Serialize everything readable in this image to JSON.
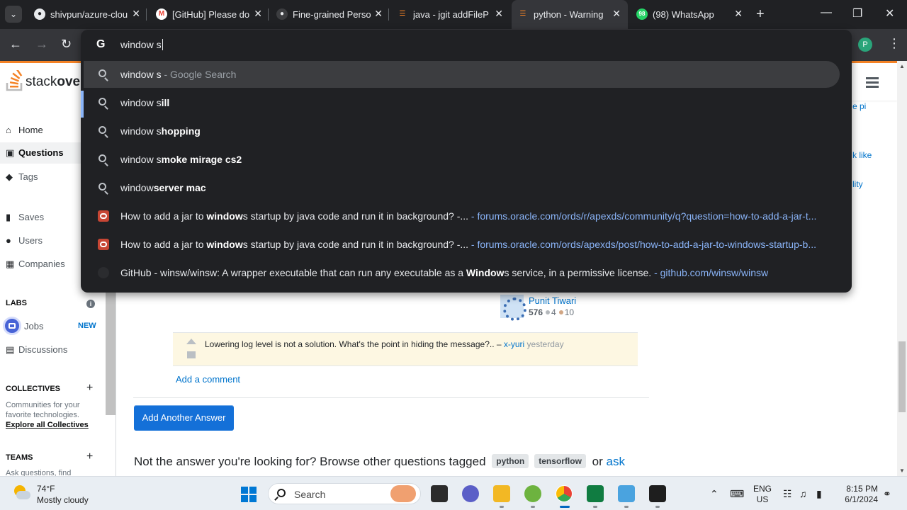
{
  "browser": {
    "tabs": [
      {
        "title": "shivpun/azure-clou",
        "icon": "github-icon"
      },
      {
        "title": "[GitHub] Please do",
        "icon": "gmail-icon"
      },
      {
        "title": "Fine-grained Perso",
        "icon": "github-icon"
      },
      {
        "title": "java - jgit addFileP",
        "icon": "stackoverflow-icon"
      },
      {
        "title": "python - Warning",
        "icon": "stackoverflow-icon",
        "active": true
      },
      {
        "title": "(98) WhatsApp",
        "icon": "whatsapp-icon"
      }
    ],
    "whatsapp_badge": "98",
    "profile_initial": "P"
  },
  "omnibox": {
    "input_text": "window s",
    "suggestions": [
      {
        "icon": "search-icon",
        "prefix": "window s",
        "bold": "",
        "suffix": "",
        "dim": " - Google Search",
        "url": ""
      },
      {
        "icon": "search-icon",
        "prefix": "window s",
        "bold": "ill",
        "suffix": "",
        "dim": "",
        "url": ""
      },
      {
        "icon": "search-icon",
        "prefix": "window s",
        "bold": "hopping",
        "suffix": "",
        "dim": "",
        "url": ""
      },
      {
        "icon": "search-icon",
        "prefix": "window s",
        "bold": "moke mirage cs2",
        "suffix": "",
        "dim": "",
        "url": ""
      },
      {
        "icon": "search-icon",
        "prefix": "window",
        "bold": "server mac",
        "suffix": "",
        "dim": "",
        "url": ""
      },
      {
        "icon": "oracle-icon",
        "prefix": "How to add a jar to ",
        "bold": "window",
        "suffix": "s startup by java code and run it in background? -...",
        "dim": "",
        "url": "  - forums.oracle.com/ords/r/apexds/community/q?question=how-to-add-a-jar-t..."
      },
      {
        "icon": "oracle-icon",
        "prefix": "How to add a jar to ",
        "bold": "window",
        "suffix": "s startup by java code and run it in background? -...",
        "dim": "",
        "url": "  - forums.oracle.com/ords/apexds/post/how-to-add-a-jar-to-windows-startup-b..."
      },
      {
        "icon": "github-icon",
        "prefix": "GitHub - winsw/winsw: A wrapper executable that can run any executable as a ",
        "bold": "Window",
        "suffix": "s service, in a permissive license.",
        "dim": "",
        "url": " - github.com/winsw/winsw"
      }
    ]
  },
  "stackoverflow": {
    "logo_text_light": "stack",
    "logo_text_bold": "over",
    "nav": {
      "home": "Home",
      "questions": "Questions",
      "tags": "Tags",
      "saves": "Saves",
      "users": "Users",
      "companies": "Companies",
      "labs_heading": "LABS",
      "jobs": "Jobs",
      "jobs_badge": "NEW",
      "discussions": "Discussions",
      "collectives_heading": "COLLECTIVES",
      "collectives_desc_1": "Communities for your",
      "collectives_desc_2": "favorite technologies.",
      "collectives_link": "Explore all Collectives",
      "teams_heading": "TEAMS",
      "teams_desc": "Ask questions, find"
    },
    "side_links": [
      "e pi",
      "k like",
      "lity"
    ],
    "author": {
      "name": "Punit Tiwari",
      "reputation": "576",
      "silver": "4",
      "bronze": "10"
    },
    "comment": {
      "text": "Lowering log level is not a solution. What's the point in hiding the message?.. – ",
      "user": "x-yuri",
      "time": " yesterday"
    },
    "add_comment": "Add a comment",
    "add_answer_button": "Add Another Answer",
    "not_answer_prefix": "Not the answer you're looking for? Browse other questions tagged ",
    "tags": [
      "python",
      "tensorflow"
    ],
    "not_answer_or": " or ",
    "not_answer_ask": "ask"
  },
  "taskbar": {
    "temperature": "74°F",
    "condition": "Mostly cloudy",
    "search_label": "Search",
    "lang_1": "ENG",
    "lang_2": "US",
    "time": "8:15 PM",
    "date": "6/1/2024"
  }
}
